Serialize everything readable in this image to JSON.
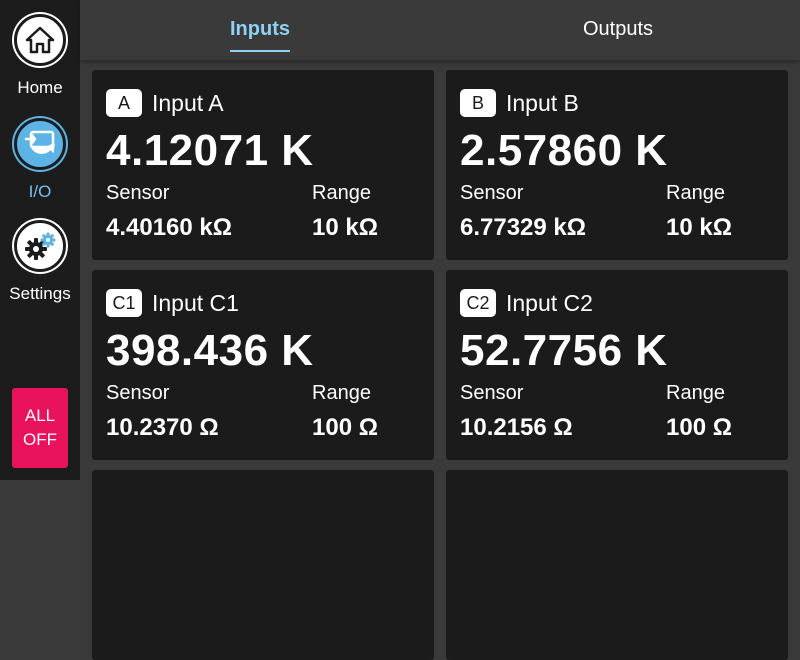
{
  "nav": {
    "home_label": "Home",
    "io_label": "I/O",
    "settings_label": "Settings",
    "all_off_label": "ALL\nOFF"
  },
  "tabs": {
    "inputs": "Inputs",
    "outputs": "Outputs",
    "active": "Inputs"
  },
  "cards": [
    {
      "badge": "A",
      "name": "Input A",
      "temperature": "4.12071 K",
      "sensor_label": "Sensor",
      "sensor_value": "4.40160 kΩ",
      "range_label": "Range",
      "range_value": "10 kΩ"
    },
    {
      "badge": "B",
      "name": "Input B",
      "temperature": "2.57860 K",
      "sensor_label": "Sensor",
      "sensor_value": "6.77329 kΩ",
      "range_label": "Range",
      "range_value": "10 kΩ"
    },
    {
      "badge": "C1",
      "name": "Input C1",
      "temperature": "398.436 K",
      "sensor_label": "Sensor",
      "sensor_value": "10.2370 Ω",
      "range_label": "Range",
      "range_value": "100 Ω"
    },
    {
      "badge": "C2",
      "name": "Input C2",
      "temperature": "52.7756 K",
      "sensor_label": "Sensor",
      "sensor_value": "10.2156 Ω",
      "range_label": "Range",
      "range_value": "100 Ω"
    }
  ],
  "colors": {
    "accent": "#8fd0f5",
    "io_active": "#5bb3e6",
    "all_off": "#e8135c",
    "card_bg": "#1b1b1b",
    "sidebar_bg": "#1c1c1c"
  }
}
